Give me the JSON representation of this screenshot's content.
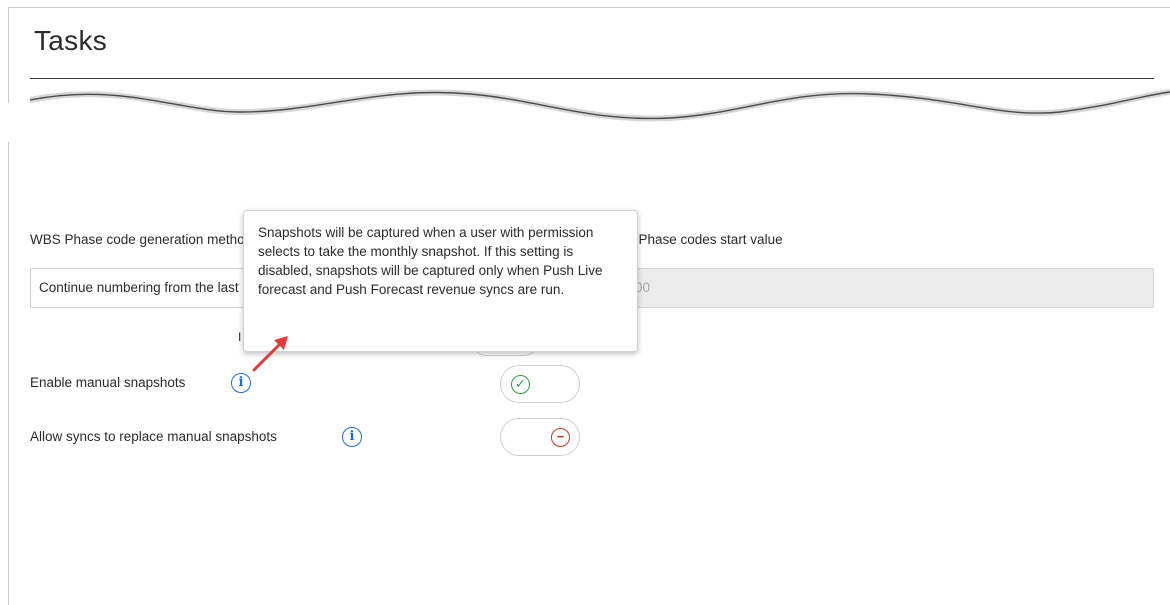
{
  "page": {
    "title": "Tasks"
  },
  "wbs": {
    "generation_label": "WBS Phase code generation method",
    "generation_value": "Continue numbering from the last existing Phase code",
    "start_label": "WBS Phase codes start value",
    "start_value": "00"
  },
  "settings": [
    {
      "label": "Enable manual snapshots",
      "state": "on",
      "icon": "check-circle-icon"
    },
    {
      "label": "Allow syncs to replace manual snapshots",
      "state": "off",
      "icon": "minus-circle-icon"
    }
  ],
  "info_icon_glyph": "i",
  "tooltip": {
    "text": "Snapshots will be captured when a user with permission selects to take the monthly snapshot. If this setting is disabled, snapshots will be captured only when Push Live forecast and Push Forecast revenue syncs are run."
  },
  "colors": {
    "accent_blue": "#1f6fd1",
    "on_green": "#2e9e4a",
    "off_red": "#c0392b",
    "arrow_red": "#e03c3c"
  }
}
